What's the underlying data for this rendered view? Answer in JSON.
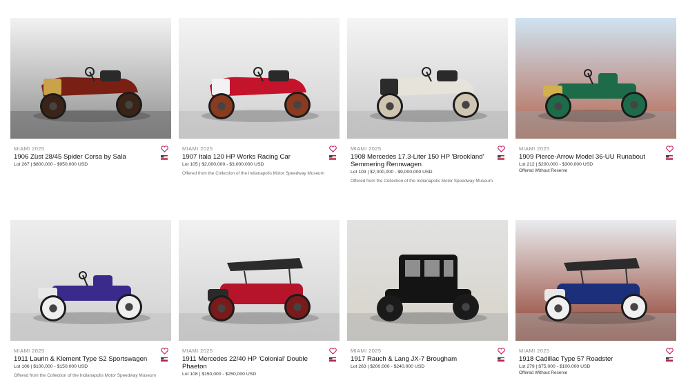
{
  "lots": [
    {
      "sale": "MIAMI 2025",
      "title": "1906 Züst 28/45 Spider Corsa by Sala",
      "lot_line": "Lot 267 | $800,000 - $950,000 USD",
      "note": "",
      "photo": {
        "bg1": "#f2f2f2",
        "bg2": "#8f8f8f",
        "floor": "#6e6e6e",
        "body": "#7a1f14",
        "accent": "#c9a24a",
        "wheel": "#3a2418",
        "style": "racer"
      }
    },
    {
      "sale": "MIAMI 2025",
      "title": "1907 Itala 120 HP Works Racing Car",
      "lot_line": "Lot 105 | $2,000,000 - $3,000,000 USD",
      "note": "Offered from the Collection of the Indianapolis Motor Speedway Museum",
      "photo": {
        "bg1": "#f4f4f4",
        "bg2": "#cfcfcf",
        "floor": "#bdbdbd",
        "body": "#c4142c",
        "accent": "#f2f2f2",
        "wheel": "#8a3a1e",
        "style": "racer"
      }
    },
    {
      "sale": "MIAMI 2025",
      "title": "1908 Mercedes 17.3-Liter 150 HP 'Brookland' Semmering Rennwagen",
      "lot_line": "Lot 103 | $7,000,000 - $9,000,000 USD",
      "note": "Offered from the Collection of the Indianapolis Motor Speedway Museum",
      "photo": {
        "bg1": "#f4f4f4",
        "bg2": "#cacaca",
        "floor": "#b8b8b8",
        "body": "#e6e3da",
        "accent": "#2b2b2b",
        "wheel": "#cfc6b2",
        "style": "racer"
      }
    },
    {
      "sale": "MIAMI 2025",
      "title": "1909 Pierce-Arrow Model 36-UU Runabout",
      "lot_line": "Lot 212 | $200,000 - $300,000 USD",
      "note": "Offered Without Reserve",
      "photo": {
        "bg1": "#cfe3f2",
        "bg2": "#b46650",
        "floor": "#9a9a9a",
        "body": "#1e6b4a",
        "accent": "#d2b04c",
        "wheel": "#1e6b4a",
        "style": "runabout"
      }
    },
    {
      "sale": "MIAMI 2025",
      "title": "1911 Laurin & Klement Type S2 Sportswagen",
      "lot_line": "Lot 106 | $100,000 - $150,000 USD",
      "note": "Offered from the Collection of the Indianapolis Motor Speedway Museum",
      "photo": {
        "bg1": "#ededed",
        "bg2": "#d0d0d0",
        "floor": "#c2c2c2",
        "body": "#3a2a8c",
        "accent": "#e8e8e8",
        "wheel": "#efefef",
        "style": "runabout"
      }
    },
    {
      "sale": "MIAMI 2025",
      "title": "1911 Mercedes 22/40 HP 'Colonial' Double Phaeton",
      "lot_line": "Lot 108 | $150,000 - $250,000 USD",
      "note": "",
      "photo": {
        "bg1": "#f1f1f1",
        "bg2": "#cfcfcf",
        "floor": "#bcbcbc",
        "body": "#b5142a",
        "accent": "#2a2a2a",
        "wheel": "#7a1a1a",
        "style": "phaeton"
      }
    },
    {
      "sale": "MIAMI 2025",
      "title": "1917 Rauch & Lang JX-7 Brougham",
      "lot_line": "Lot 263 | $200,000 - $240,000 USD",
      "note": "",
      "photo": {
        "bg1": "#e2e2e2",
        "bg2": "#d6d2c8",
        "floor": "#b3b3b3",
        "body": "#141414",
        "accent": "#555555",
        "wheel": "#1a1a1a",
        "style": "brougham"
      }
    },
    {
      "sale": "MIAMI 2025",
      "title": "1918 Cadillac Type 57 Roadster",
      "lot_line": "Lot 279 | $75,000 - $100,000 USD",
      "note": "Offered Without Reserve",
      "photo": {
        "bg1": "#e9ecef",
        "bg2": "#8e3b2a",
        "floor": "#a6a6a6",
        "body": "#1c2f7a",
        "accent": "#e8e8e8",
        "wheel": "#f0f0f0",
        "style": "phaeton"
      }
    }
  ],
  "icons": {
    "favorite": "heart-icon",
    "country": "us-flag-icon"
  },
  "colors": {
    "heart": "#c2185b",
    "flag_red": "#b22234",
    "flag_blue": "#3c3b6e"
  }
}
